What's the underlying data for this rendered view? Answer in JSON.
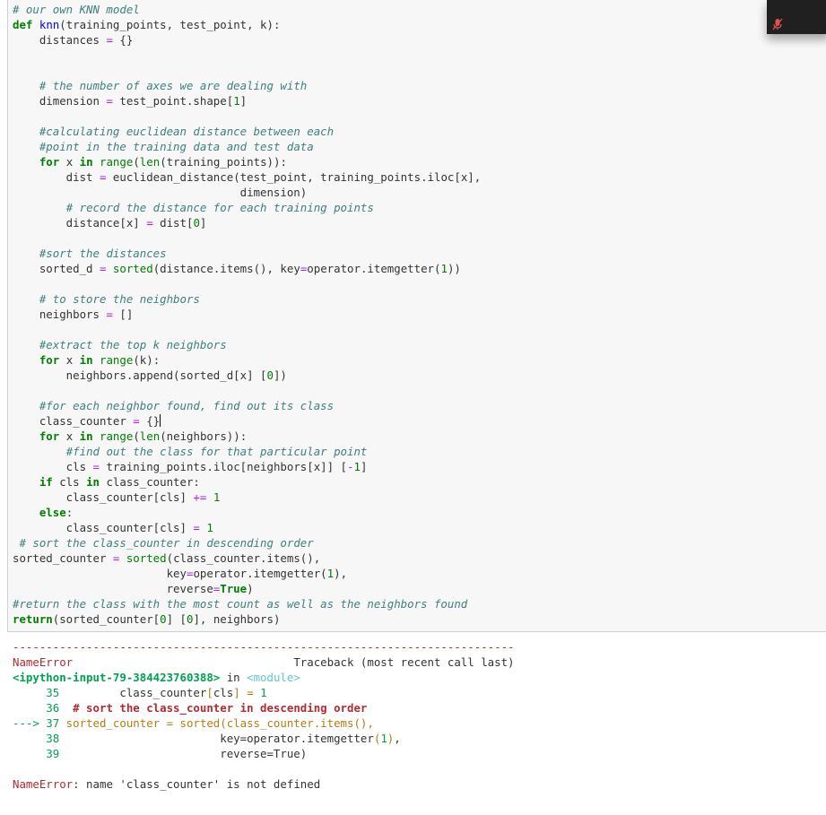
{
  "cell": {
    "lines": [
      [
        {
          "t": "c",
          "v": "# our own KNN model"
        }
      ],
      [
        {
          "t": "k",
          "v": "def"
        },
        {
          "t": "p",
          "v": " "
        },
        {
          "t": "nf",
          "v": "knn"
        },
        {
          "t": "p",
          "v": "(training_points, test_point, k):"
        }
      ],
      [
        {
          "t": "p",
          "v": "    distances "
        },
        {
          "t": "o",
          "v": "="
        },
        {
          "t": "p",
          "v": " {}"
        }
      ],
      [],
      [],
      [
        {
          "t": "p",
          "v": "    "
        },
        {
          "t": "c",
          "v": "# the number of axes we are dealing with"
        }
      ],
      [
        {
          "t": "p",
          "v": "    dimension "
        },
        {
          "t": "o",
          "v": "="
        },
        {
          "t": "p",
          "v": " test_point.shape["
        },
        {
          "t": "mi",
          "v": "1"
        },
        {
          "t": "p",
          "v": "]"
        }
      ],
      [],
      [
        {
          "t": "p",
          "v": "    "
        },
        {
          "t": "c",
          "v": "#calculating euclidean distance between each"
        }
      ],
      [
        {
          "t": "p",
          "v": "    "
        },
        {
          "t": "c",
          "v": "#point in the training data and test data"
        }
      ],
      [
        {
          "t": "p",
          "v": "    "
        },
        {
          "t": "k",
          "v": "for"
        },
        {
          "t": "p",
          "v": " x "
        },
        {
          "t": "k",
          "v": "in"
        },
        {
          "t": "p",
          "v": " "
        },
        {
          "t": "nb",
          "v": "range"
        },
        {
          "t": "p",
          "v": "("
        },
        {
          "t": "nb",
          "v": "len"
        },
        {
          "t": "p",
          "v": "(training_points)):"
        }
      ],
      [
        {
          "t": "p",
          "v": "        dist "
        },
        {
          "t": "o",
          "v": "="
        },
        {
          "t": "p",
          "v": " euclidean_distance(test_point, training_points.iloc[x],"
        }
      ],
      [
        {
          "t": "p",
          "v": "                                  dimension)"
        }
      ],
      [
        {
          "t": "p",
          "v": "        "
        },
        {
          "t": "c",
          "v": "# record the distance for each training points"
        }
      ],
      [
        {
          "t": "p",
          "v": "        distance[x] "
        },
        {
          "t": "o",
          "v": "="
        },
        {
          "t": "p",
          "v": " dist["
        },
        {
          "t": "mi",
          "v": "0"
        },
        {
          "t": "p",
          "v": "]"
        }
      ],
      [],
      [
        {
          "t": "p",
          "v": "    "
        },
        {
          "t": "c",
          "v": "#sort the distances"
        }
      ],
      [
        {
          "t": "p",
          "v": "    sorted_d "
        },
        {
          "t": "o",
          "v": "="
        },
        {
          "t": "p",
          "v": " "
        },
        {
          "t": "nb",
          "v": "sorted"
        },
        {
          "t": "p",
          "v": "(distance.items(), key"
        },
        {
          "t": "o",
          "v": "="
        },
        {
          "t": "p",
          "v": "operator.itemgetter("
        },
        {
          "t": "mi",
          "v": "1"
        },
        {
          "t": "p",
          "v": "))"
        }
      ],
      [],
      [
        {
          "t": "p",
          "v": "    "
        },
        {
          "t": "c",
          "v": "# to store the neighbors"
        }
      ],
      [
        {
          "t": "p",
          "v": "    neighbors "
        },
        {
          "t": "o",
          "v": "="
        },
        {
          "t": "p",
          "v": " []"
        }
      ],
      [],
      [
        {
          "t": "p",
          "v": "    "
        },
        {
          "t": "c",
          "v": "#extract the top k neighbors"
        }
      ],
      [
        {
          "t": "p",
          "v": "    "
        },
        {
          "t": "k",
          "v": "for"
        },
        {
          "t": "p",
          "v": " x "
        },
        {
          "t": "k",
          "v": "in"
        },
        {
          "t": "p",
          "v": " "
        },
        {
          "t": "nb",
          "v": "range"
        },
        {
          "t": "p",
          "v": "(k):"
        }
      ],
      [
        {
          "t": "p",
          "v": "        neighbors.append(sorted_d[x] ["
        },
        {
          "t": "mi",
          "v": "0"
        },
        {
          "t": "p",
          "v": "])"
        }
      ],
      [],
      [
        {
          "t": "p",
          "v": "    "
        },
        {
          "t": "c",
          "v": "#for each neighbor found, find out its class"
        }
      ],
      [
        {
          "t": "p",
          "v": "    class_counter "
        },
        {
          "t": "o",
          "v": "="
        },
        {
          "t": "p",
          "v": " {}"
        },
        {
          "t": "cursor",
          "v": ""
        }
      ],
      [
        {
          "t": "p",
          "v": "    "
        },
        {
          "t": "k",
          "v": "for"
        },
        {
          "t": "p",
          "v": " x "
        },
        {
          "t": "k",
          "v": "in"
        },
        {
          "t": "p",
          "v": " "
        },
        {
          "t": "nb",
          "v": "range"
        },
        {
          "t": "p",
          "v": "("
        },
        {
          "t": "nb",
          "v": "len"
        },
        {
          "t": "p",
          "v": "(neighbors)):"
        }
      ],
      [
        {
          "t": "p",
          "v": "        "
        },
        {
          "t": "c",
          "v": "#find out the class for that particular point"
        }
      ],
      [
        {
          "t": "p",
          "v": "        cls "
        },
        {
          "t": "o",
          "v": "="
        },
        {
          "t": "p",
          "v": " training_points.iloc[neighbors[x]] ["
        },
        {
          "t": "o",
          "v": "-"
        },
        {
          "t": "mi",
          "v": "1"
        },
        {
          "t": "p",
          "v": "]"
        }
      ],
      [
        {
          "t": "p",
          "v": "    "
        },
        {
          "t": "k",
          "v": "if"
        },
        {
          "t": "p",
          "v": " cls "
        },
        {
          "t": "k",
          "v": "in"
        },
        {
          "t": "p",
          "v": " class_counter:"
        }
      ],
      [
        {
          "t": "p",
          "v": "        class_counter[cls] "
        },
        {
          "t": "o",
          "v": "+="
        },
        {
          "t": "p",
          "v": " "
        },
        {
          "t": "mi",
          "v": "1"
        }
      ],
      [
        {
          "t": "p",
          "v": "    "
        },
        {
          "t": "k",
          "v": "else"
        },
        {
          "t": "p",
          "v": ":"
        }
      ],
      [
        {
          "t": "p",
          "v": "        class_counter[cls] "
        },
        {
          "t": "o",
          "v": "="
        },
        {
          "t": "p",
          "v": " "
        },
        {
          "t": "mi",
          "v": "1"
        }
      ],
      [
        {
          "t": "p",
          "v": " "
        },
        {
          "t": "c",
          "v": "# sort the class_counter in descending order"
        }
      ],
      [
        {
          "t": "p",
          "v": "sorted_counter "
        },
        {
          "t": "o",
          "v": "="
        },
        {
          "t": "p",
          "v": " "
        },
        {
          "t": "nb",
          "v": "sorted"
        },
        {
          "t": "p",
          "v": "(class_counter.items(),"
        }
      ],
      [
        {
          "t": "p",
          "v": "                       key"
        },
        {
          "t": "o",
          "v": "="
        },
        {
          "t": "p",
          "v": "operator.itemgetter("
        },
        {
          "t": "mi",
          "v": "1"
        },
        {
          "t": "p",
          "v": "),"
        }
      ],
      [
        {
          "t": "p",
          "v": "                       reverse"
        },
        {
          "t": "o",
          "v": "="
        },
        {
          "t": "k",
          "v": "True"
        },
        {
          "t": "p",
          "v": ")"
        }
      ],
      [
        {
          "t": "c",
          "v": "#return the class with the most count as well as the neighbors found"
        }
      ],
      [
        {
          "t": "k",
          "v": "return"
        },
        {
          "t": "p",
          "v": "(sorted_counter["
        },
        {
          "t": "mi",
          "v": "0"
        },
        {
          "t": "p",
          "v": "] ["
        },
        {
          "t": "mi",
          "v": "0"
        },
        {
          "t": "p",
          "v": "], neighbors)"
        }
      ]
    ]
  },
  "output": {
    "lines": [
      [
        {
          "t": "dash",
          "v": "---------------------------------------------------------------------------"
        }
      ],
      [
        {
          "t": "tb-red",
          "v": "NameError"
        },
        {
          "t": "p",
          "v": "                                 Traceback (most recent call last)"
        }
      ],
      [
        {
          "t": "tb-green-b",
          "v": "<ipython-input-79-384423760388>"
        },
        {
          "t": "p",
          "v": " in "
        },
        {
          "t": "tb-cyan",
          "v": "<module>"
        }
      ],
      [
        {
          "t": "tb-num",
          "v": "     35"
        },
        {
          "t": "p",
          "v": "         class_counter"
        },
        {
          "t": "tb-yellow",
          "v": "["
        },
        {
          "t": "p",
          "v": "cls"
        },
        {
          "t": "tb-yellow",
          "v": "]"
        },
        {
          "t": "p",
          "v": " "
        },
        {
          "t": "tb-yellow",
          "v": "="
        },
        {
          "t": "p",
          "v": " "
        },
        {
          "t": "tb-num",
          "v": "1"
        }
      ],
      [
        {
          "t": "tb-num",
          "v": "     36"
        },
        {
          "t": "p",
          "v": "  "
        },
        {
          "t": "tb-red-b",
          "v": "# sort the class_counter in descending order"
        }
      ],
      [
        {
          "t": "tb-green",
          "v": "---> 37"
        },
        {
          "t": "tb-yellow",
          "v": " sorted_counter = sorted(class_counter.items(),"
        }
      ],
      [
        {
          "t": "tb-num",
          "v": "     38"
        },
        {
          "t": "p",
          "v": "                        key=operator.itemgetter"
        },
        {
          "t": "tb-yellow",
          "v": "("
        },
        {
          "t": "tb-num",
          "v": "1"
        },
        {
          "t": "tb-yellow",
          "v": ")"
        },
        {
          "t": "p",
          "v": ","
        }
      ],
      [
        {
          "t": "tb-num",
          "v": "     39"
        },
        {
          "t": "p",
          "v": "                        reverse=True)"
        }
      ],
      [],
      [
        {
          "t": "tb-red",
          "v": "NameError"
        },
        {
          "t": "p",
          "v": ": name 'class_counter' is not defined"
        }
      ]
    ]
  },
  "overlay": {
    "icon": "muted-microphone-icon",
    "colors": {
      "background": "#202020",
      "icon": "#e05050"
    }
  },
  "colors": {
    "cell_background": "#f7f7f7",
    "comment": "#408080",
    "keyword": "#008000",
    "function_name": "#0000ff",
    "operator": "#aa22ff",
    "error_red": "#b22b31",
    "traceback_green": "#00a250",
    "traceback_yellow": "#b27d12"
  }
}
